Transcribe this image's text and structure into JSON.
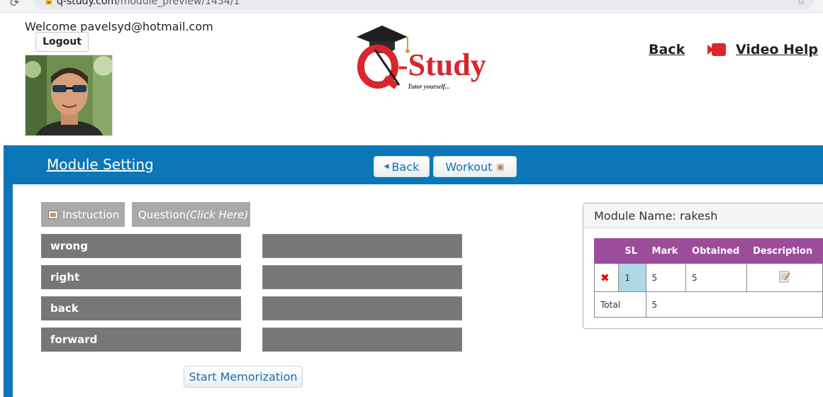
{
  "browser": {
    "url_host": "q-study.com",
    "url_path": "/module_preview/1434/1"
  },
  "header": {
    "welcome_text": "Welcome pavelsyd@hotmail.com",
    "logout_label": "Logout",
    "logo_text": "Q-Study",
    "logo_tagline": "Tutor yourself...",
    "back_label": "Back",
    "video_help_label": "Video Help"
  },
  "toolbar": {
    "module_setting_label": "Module Setting",
    "back_label": "Back",
    "workout_label": "Workout"
  },
  "tabs": {
    "instruction_label": "Instruction",
    "question_label": "Question",
    "question_hint": "(Click Here)"
  },
  "words": [
    "wrong",
    "right",
    "back",
    "forward"
  ],
  "answers": [
    "",
    "",
    "",
    ""
  ],
  "start_button_label": "Start Memorization",
  "module_panel": {
    "title": "Module Name: rakesh",
    "columns": [
      "",
      "SL",
      "Mark",
      "Obtained",
      "Description"
    ],
    "rows": [
      {
        "status": "✖",
        "sl": "1",
        "mark": "5",
        "obtained": "5"
      }
    ],
    "total_label": "Total",
    "total_value": "5"
  },
  "colors": {
    "band_blue": "#0b76b8",
    "table_header_purple": "#9b4d9b",
    "word_box_gray": "#777777",
    "logo_red": "#d9252b",
    "sl_highlight": "#add8e6"
  }
}
